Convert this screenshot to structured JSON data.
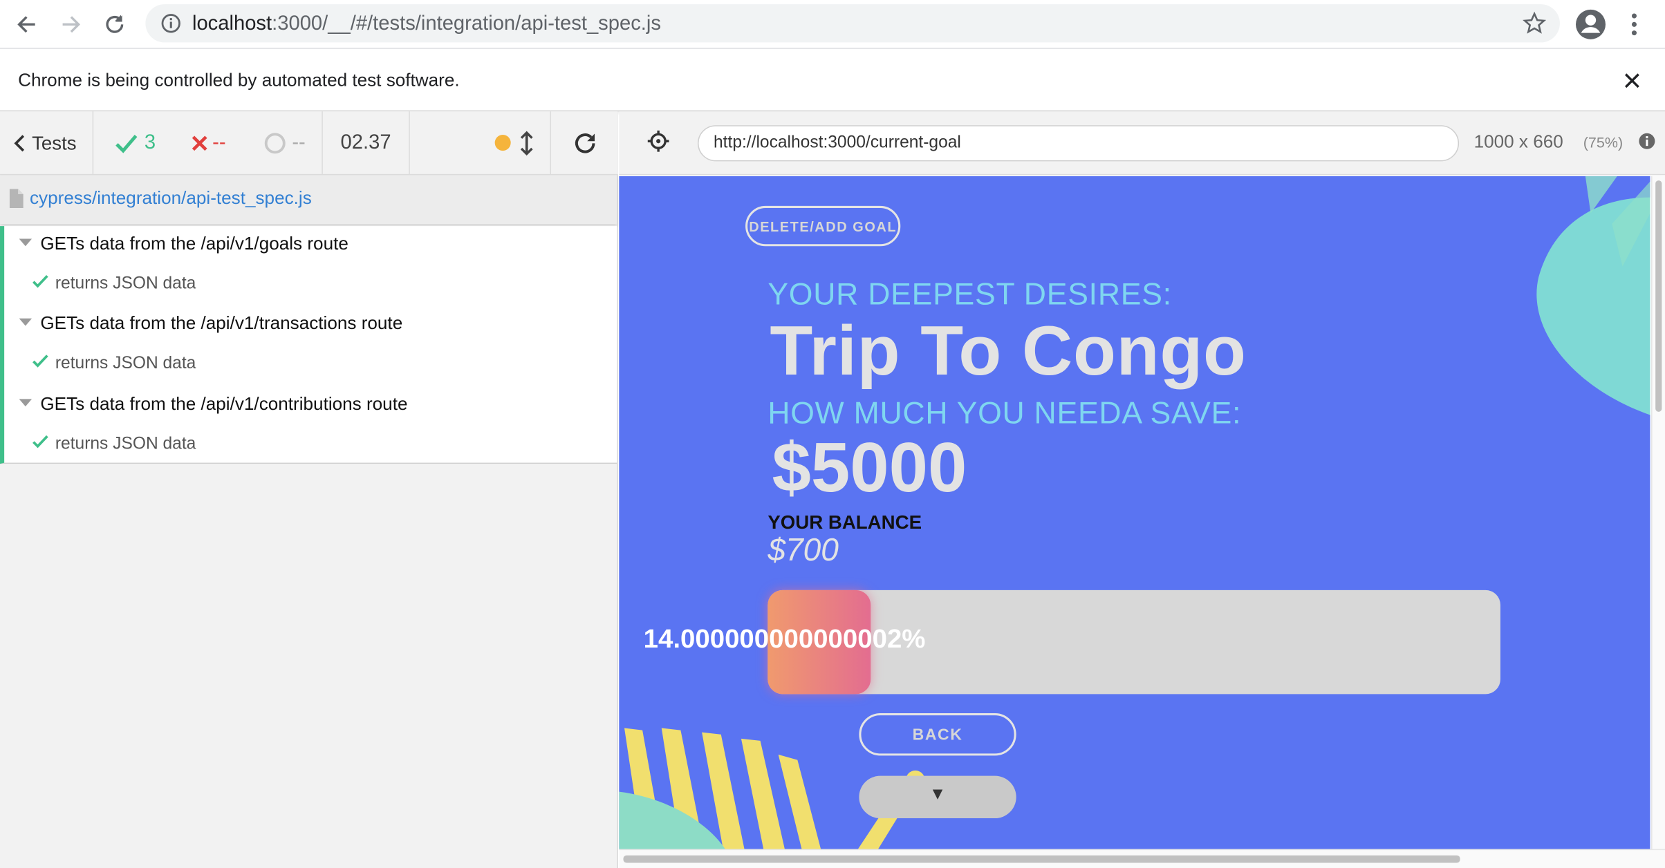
{
  "browser": {
    "url_host": "localhost",
    "url_rest": ":3000/__/#/tests/integration/api-test_spec.js",
    "infobar_text": "Chrome is being controlled by automated test software.",
    "icons": [
      "back-icon",
      "forward-icon",
      "reload-icon",
      "info-icon",
      "star-icon",
      "profile-icon",
      "menu-icon",
      "close-icon"
    ]
  },
  "reporter": {
    "tests_label": "Tests",
    "passed": "3",
    "failed": "--",
    "pending": "--",
    "duration": "02.37",
    "spec_path": "cypress/integration/api-test_spec.js",
    "suites": [
      {
        "title": "GETs data from the /api/v1/goals route",
        "test": "returns JSON data"
      },
      {
        "title": "GETs data from the /api/v1/transactions route",
        "test": "returns JSON data"
      },
      {
        "title": "GETs data from the /api/v1/contributions route",
        "test": "returns JSON data"
      }
    ],
    "colors": {
      "pass": "#3fbf8a",
      "fail": "#e1403d",
      "running": "#f5b43c",
      "link": "#3380d3"
    }
  },
  "aut": {
    "url": "http://localhost:3000/current-goal",
    "viewport": "1000 x 660",
    "scale": "(75%)"
  },
  "app": {
    "delete_add_label": "DELETE/ADD GOAL",
    "desires_label": "YOUR DEEPEST DESIRES:",
    "goal_title": "Trip To Congo",
    "save_label": "HOW MUCH YOU NEEDA SAVE:",
    "goal_amount": "$5000",
    "balance_label": "YOUR BALANCE",
    "balance_amount": "$700",
    "progress_text": "14.000000000000002%",
    "progress_fraction": 0.14,
    "back_label": "BACK",
    "toggle_glyph": "▼",
    "colors": {
      "background": "#5a74f2",
      "accent_text": "#7fd6f0",
      "bar_track": "#d8d8d8",
      "bar_fill_start": "#f09a6e",
      "bar_fill_end": "#e36d90",
      "stripes": "#f1df6e",
      "blob": "#7edfd0"
    }
  }
}
